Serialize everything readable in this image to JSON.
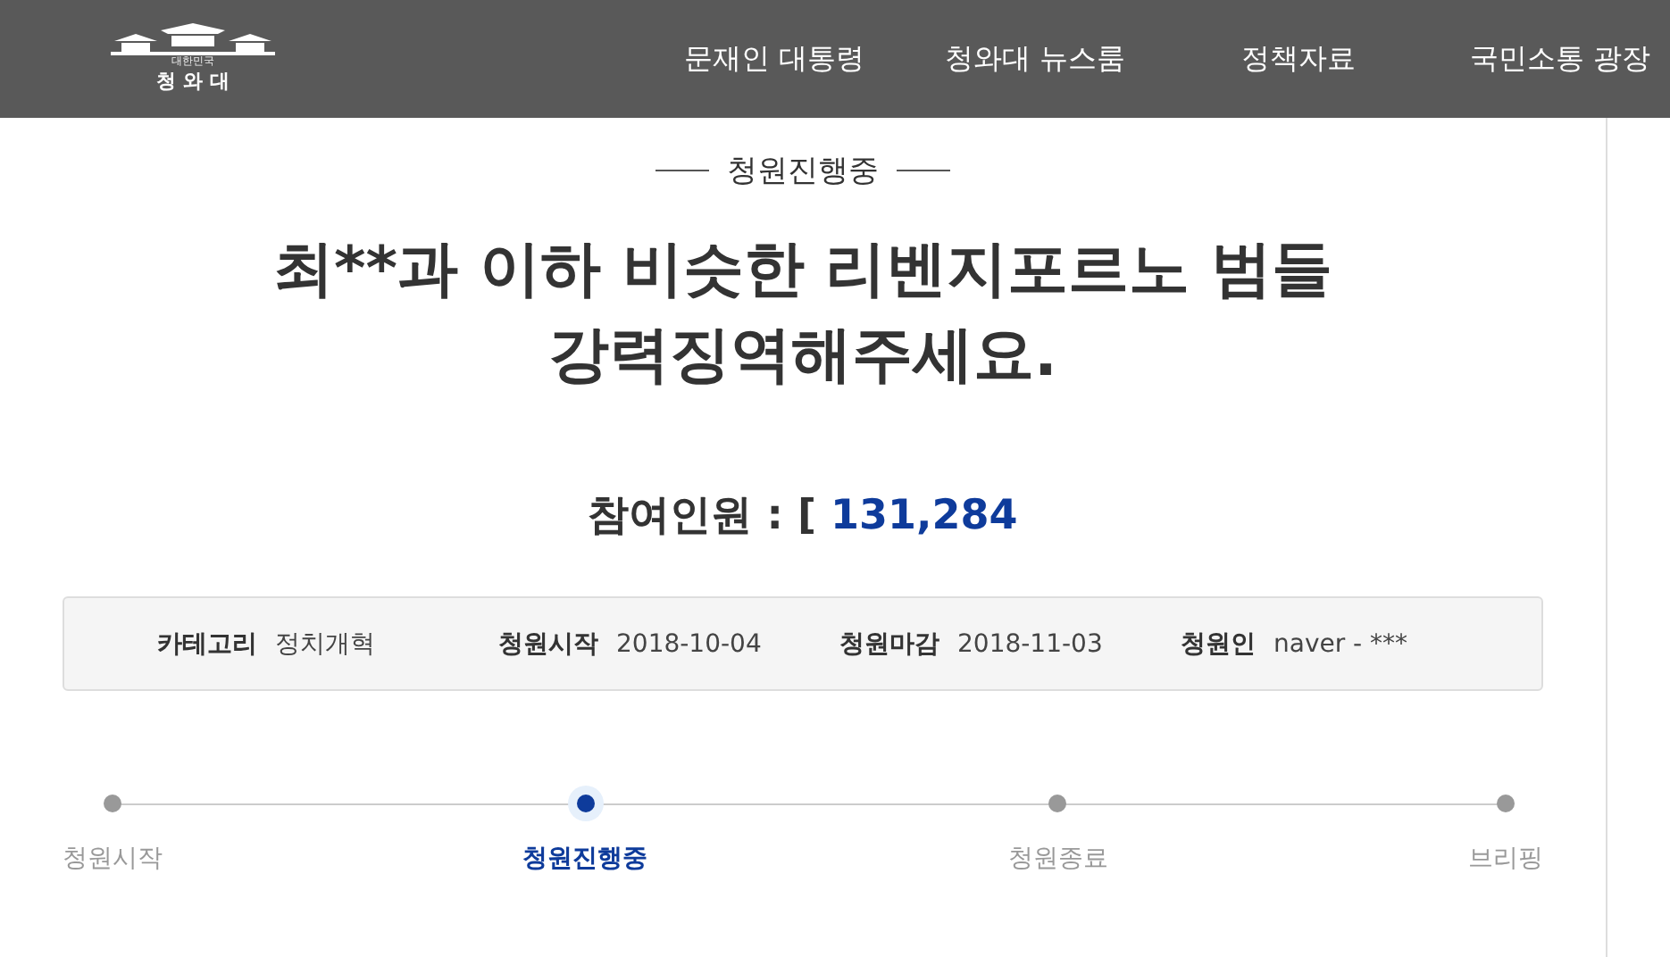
{
  "header": {
    "logo": {
      "subtitle": "대한민국",
      "title": "청 와 대"
    },
    "nav": [
      {
        "label": "문재인 대통령"
      },
      {
        "label": "청와대 뉴스룸"
      },
      {
        "label": "정책자료"
      },
      {
        "label": "국민소통 광장"
      }
    ]
  },
  "petition": {
    "status": "청원진행중",
    "title": "최**과 이하 비슷한 리벤지포르노 범들 강력징역해주세요.",
    "count_label": "참여인원 : [",
    "count": "131,284",
    "info": [
      {
        "label": "카테고리",
        "value": "정치개혁"
      },
      {
        "label": "청원시작",
        "value": "2018-10-04"
      },
      {
        "label": "청원마감",
        "value": "2018-11-03"
      },
      {
        "label": "청원인",
        "value": "naver - ***"
      }
    ],
    "steps": [
      {
        "label": "청원시작",
        "selected": false
      },
      {
        "label": "청원진행중",
        "selected": true
      },
      {
        "label": "청원종료",
        "selected": false
      },
      {
        "label": "브리핑",
        "selected": false
      }
    ]
  }
}
